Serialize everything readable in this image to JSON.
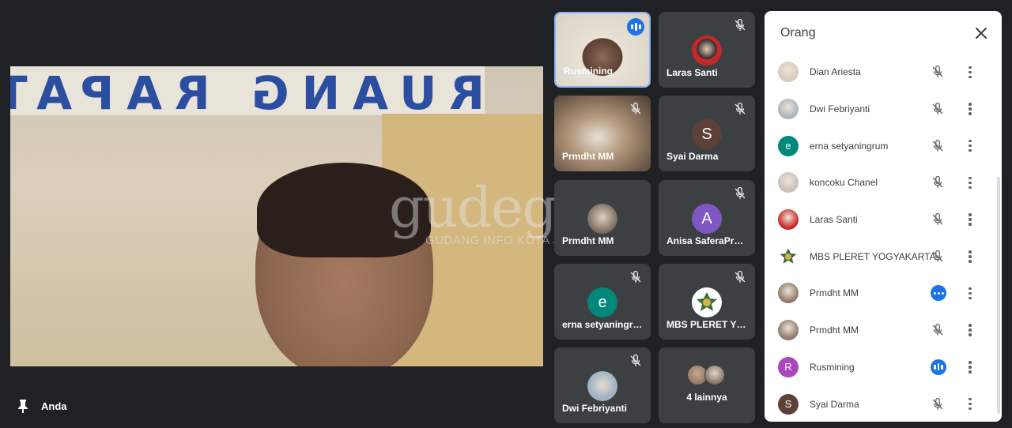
{
  "main_video": {
    "banner_text": "RUANG RAPAT FKIP",
    "watermark": "gudegnet",
    "watermark_sub": "GUDANG INFO KOTA JOGJA",
    "self_label": "Anda"
  },
  "tiles": [
    {
      "name": "Rusmining",
      "state": "speaking",
      "kind": "photo"
    },
    {
      "name": "Laras Santi",
      "state": "muted",
      "kind": "photo-avatar"
    },
    {
      "name": "Prmdht MM",
      "state": "muted",
      "kind": "photo"
    },
    {
      "name": "Syai Darma",
      "state": "muted",
      "kind": "letter",
      "letter": "S",
      "color": "#5d4037"
    },
    {
      "name": "Prmdht MM",
      "state": "none",
      "kind": "photo-avatar"
    },
    {
      "name": "Anisa SaferaProb…",
      "state": "muted",
      "kind": "letter",
      "letter": "A",
      "color": "#7e57c2"
    },
    {
      "name": "erna setyaningru…",
      "state": "muted",
      "kind": "letter",
      "letter": "e",
      "color": "#00897b"
    },
    {
      "name": "MBS PLERET YO…",
      "state": "muted",
      "kind": "logo"
    },
    {
      "name": "Dwi Febriyanti",
      "state": "muted",
      "kind": "photo-avatar"
    },
    {
      "name": "4 lainnya",
      "state": "none",
      "kind": "more"
    }
  ],
  "panel": {
    "title": "Orang",
    "participants": [
      {
        "name": "Dian Ariesta",
        "status": "muted",
        "avatar": "photo",
        "color": "#d8cbb8"
      },
      {
        "name": "Dwi Febriyanti",
        "status": "muted",
        "avatar": "photo",
        "color": "#a9b4bd"
      },
      {
        "name": "erna setyaningrum",
        "status": "muted",
        "avatar": "letter",
        "letter": "e",
        "color": "#00897b"
      },
      {
        "name": "koncoku Chanel",
        "status": "muted",
        "avatar": "photo",
        "color": "#c9bfb8"
      },
      {
        "name": "Laras Santi",
        "status": "muted",
        "avatar": "photo",
        "color": "#c62828"
      },
      {
        "name": "MBS PLERET YOGYAKARTA",
        "status": "muted",
        "avatar": "logo",
        "color": "#ffffff"
      },
      {
        "name": "Prmdht MM",
        "status": "more",
        "avatar": "photo",
        "color": "#8d7a6a"
      },
      {
        "name": "Prmdht MM",
        "status": "muted",
        "avatar": "photo",
        "color": "#8d7a6a"
      },
      {
        "name": "Rusmining",
        "status": "speaking",
        "avatar": "letter",
        "letter": "R",
        "color": "#ab47bc"
      },
      {
        "name": "Syai Darma",
        "status": "muted",
        "avatar": "letter",
        "letter": "S",
        "color": "#5d4037"
      }
    ]
  },
  "colors": {
    "accent": "#1a73e8",
    "tile_bg": "#3c4043",
    "background": "#202124"
  }
}
